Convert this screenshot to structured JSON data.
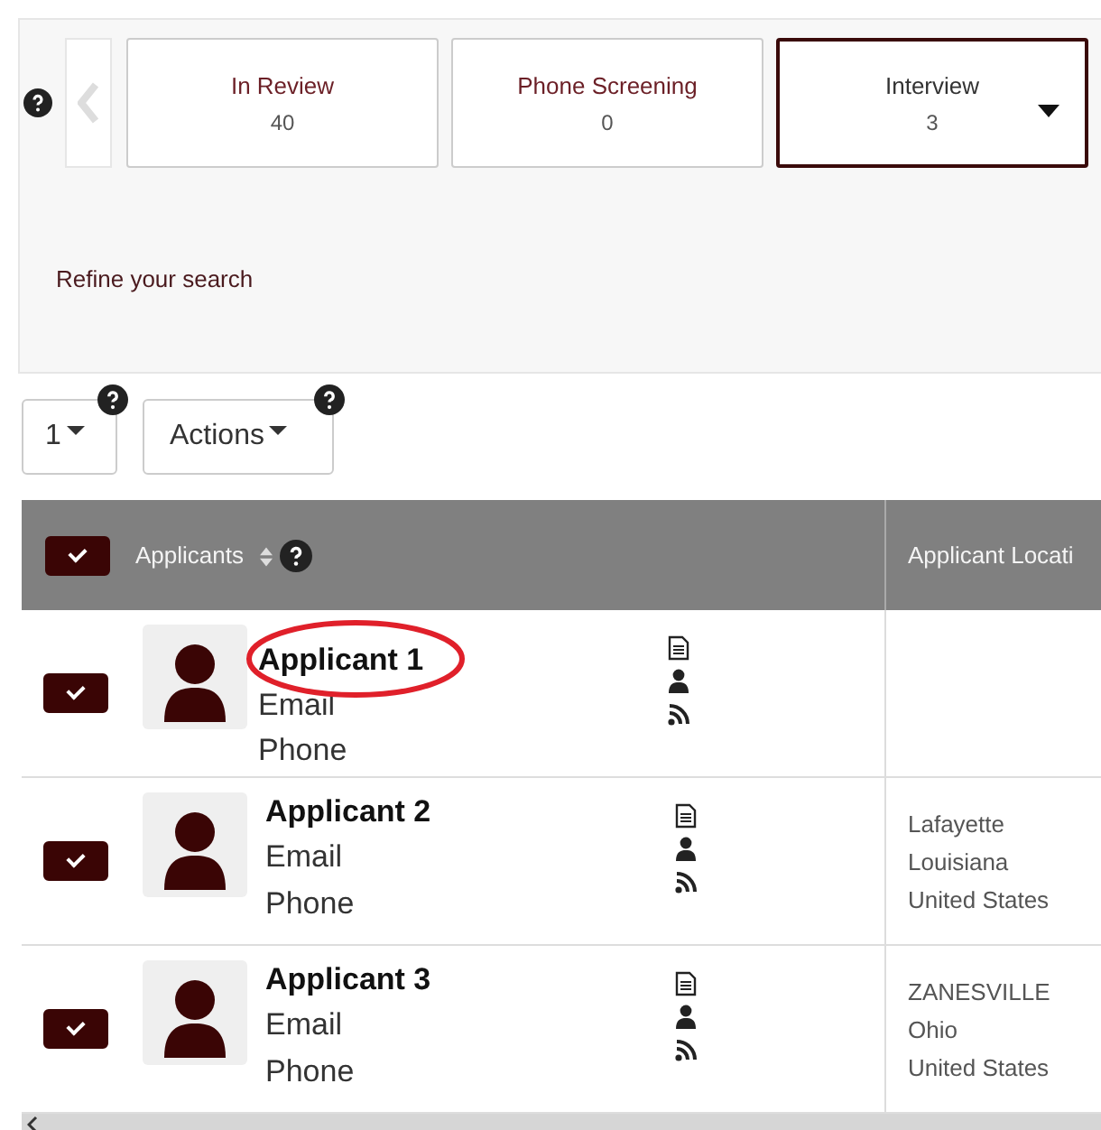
{
  "stage_tabs": [
    {
      "label": "In Review",
      "count": "40",
      "selected": false
    },
    {
      "label": "Phone Screening",
      "count": "0",
      "selected": false
    },
    {
      "label": "Interview",
      "count": "3",
      "selected": true
    }
  ],
  "refine_link": "Refine your search",
  "toolbar": {
    "page_button": "1",
    "actions_button": "Actions"
  },
  "table": {
    "header_checked": true,
    "columns": [
      "Applicants",
      "Applicant Locati"
    ],
    "rows": [
      {
        "name": "Applicant 1",
        "email": "Email",
        "phone": "Phone",
        "checked": true,
        "circled": true
      },
      {
        "name": "Applicant 2",
        "email": "Email",
        "phone": "Phone",
        "checked": true,
        "circled": false,
        "location": [
          "Lafayette",
          "Louisiana",
          "United States"
        ]
      },
      {
        "name": "Applicant 3",
        "email": "Email",
        "phone": "Phone",
        "checked": true,
        "circled": false,
        "location": [
          "ZANESVILLE",
          "Ohio",
          "United States"
        ]
      }
    ]
  }
}
